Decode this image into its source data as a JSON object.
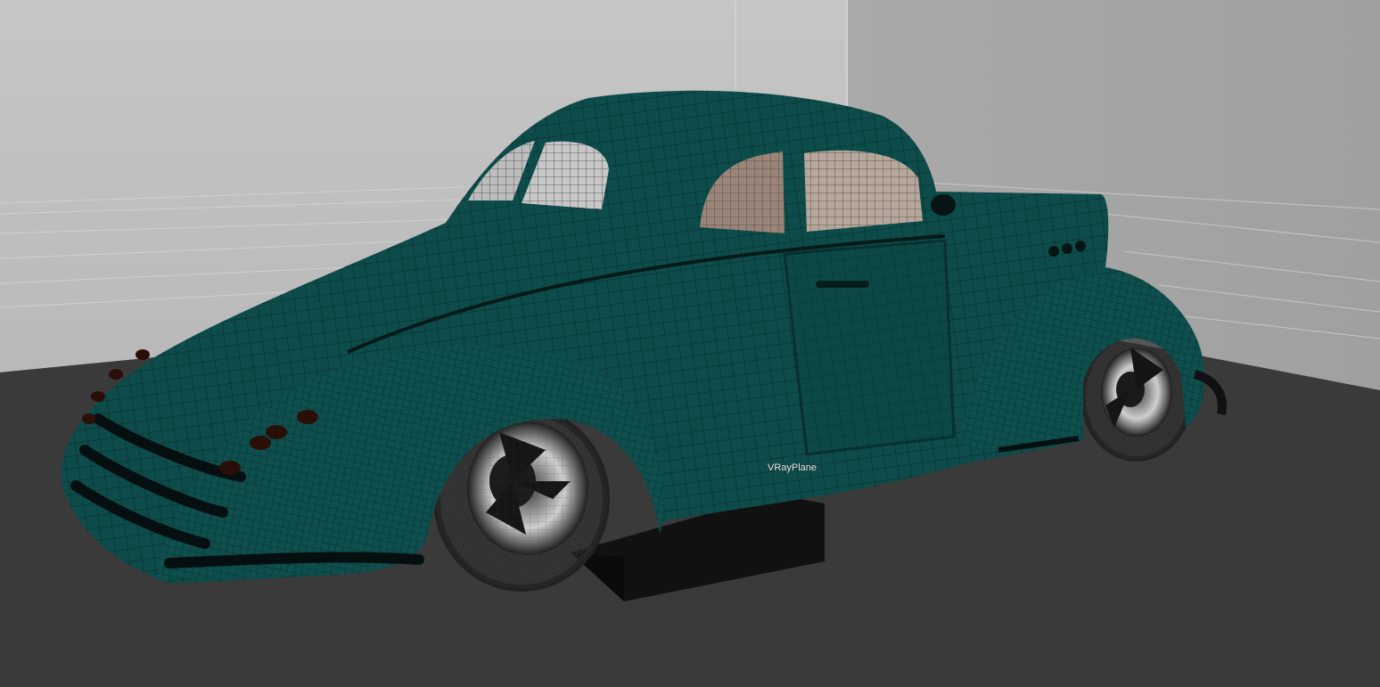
{
  "viewport": {
    "object_label": "VRayPlane"
  },
  "colors": {
    "body_paint": "#0d4c4a",
    "wireframe": "#062423",
    "back_wall": "#bfbfbf",
    "side_wall": "#a8a8a8",
    "floor": "#3a3a3a"
  }
}
